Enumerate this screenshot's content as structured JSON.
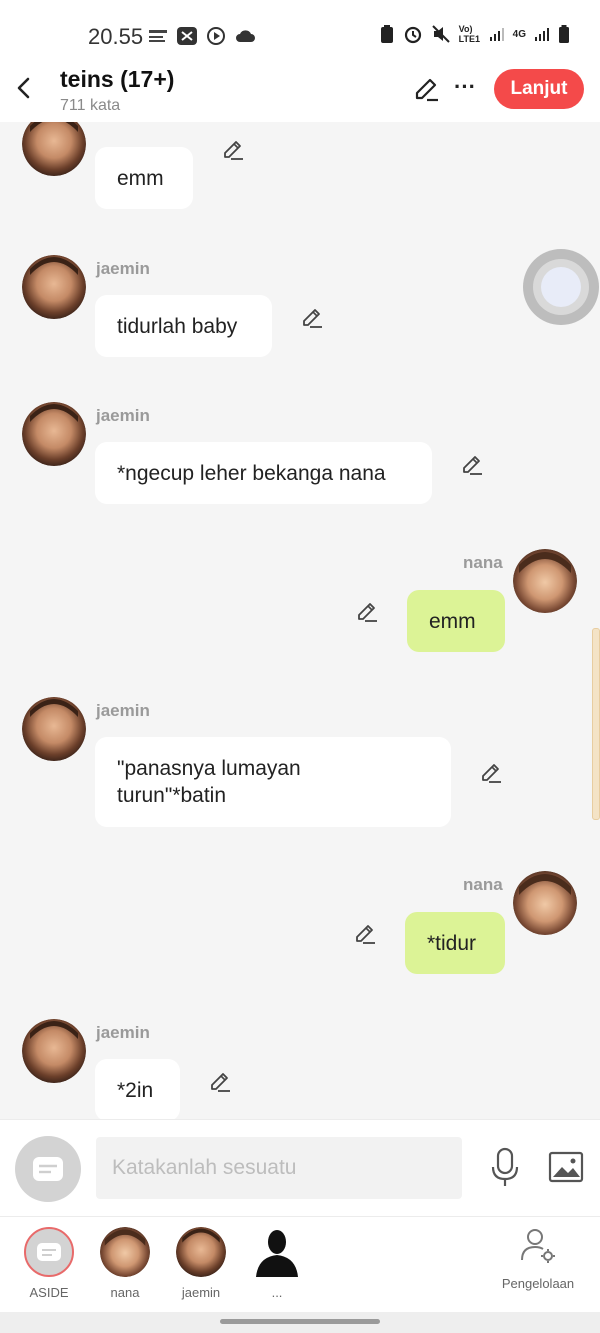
{
  "status_bar": {
    "time": "20.55",
    "network": "4G",
    "volte": "Vo) LTE1"
  },
  "header": {
    "title": "teins (17+)",
    "word_count": "711 kata",
    "next_label": "Lanjut"
  },
  "messages": [
    {
      "sender": "jaemin",
      "side": "left",
      "text": "emm"
    },
    {
      "sender": "jaemin",
      "side": "left",
      "text": "tidurlah baby"
    },
    {
      "sender": "jaemin",
      "side": "left",
      "text": "*ngecup leher bekanga nana"
    },
    {
      "sender": "nana",
      "side": "right",
      "text": "emm"
    },
    {
      "sender": "jaemin",
      "side": "left",
      "text": "\"panasnya lumayan turun\"*batin"
    },
    {
      "sender": "nana",
      "side": "right",
      "text": "*tidur"
    },
    {
      "sender": "jaemin",
      "side": "left",
      "text": "*2in"
    }
  ],
  "composer": {
    "placeholder": "Katakanlah sesuatu"
  },
  "characters": [
    {
      "label": "ASIDE"
    },
    {
      "label": "nana"
    },
    {
      "label": "jaemin"
    },
    {
      "label": "..."
    }
  ],
  "manage_label": "Pengelolaan",
  "colors": {
    "accent": "#f44a4a",
    "right_bubble": "#dcf396",
    "left_bubble": "#ffffff",
    "background": "#f5f5f5"
  }
}
